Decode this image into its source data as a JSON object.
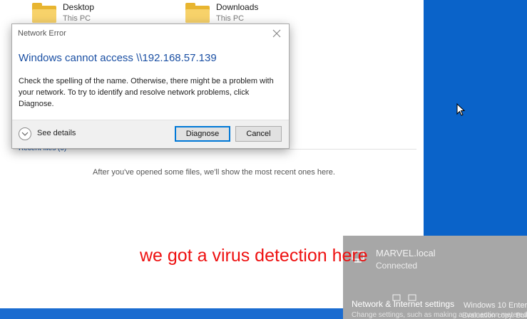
{
  "explorer": {
    "quick_access": [
      {
        "name": "Desktop",
        "location": "This PC"
      },
      {
        "name": "Downloads",
        "location": "This PC"
      }
    ],
    "recent_header": "Recent files (0)",
    "recent_empty": "After you've opened some files, we'll show the most recent ones here."
  },
  "dialog": {
    "title": "Network Error",
    "heading": "Windows cannot access \\\\192.168.57.139",
    "body": "Check the spelling of the name. Otherwise, there might be a problem with your network. To try to identify and resolve network problems, click Diagnose.",
    "see_details": "See details",
    "diagnose_label": "Diagnose",
    "cancel_label": "Cancel"
  },
  "flyout": {
    "network_name": "MARVEL.local",
    "status": "Connected",
    "settings_title": "Network & Internet settings",
    "settings_desc": "Change settings, such as making a connection metered."
  },
  "watermark": {
    "line1": "Windows 10 Enter",
    "line2": "Evaluation copy. Build"
  },
  "caption": "we got a virus detection here",
  "colors": {
    "desktop": "#0a63c9",
    "accent": "#0078d7",
    "caption": "#ee1010",
    "flyout": "#a7a7a7"
  }
}
